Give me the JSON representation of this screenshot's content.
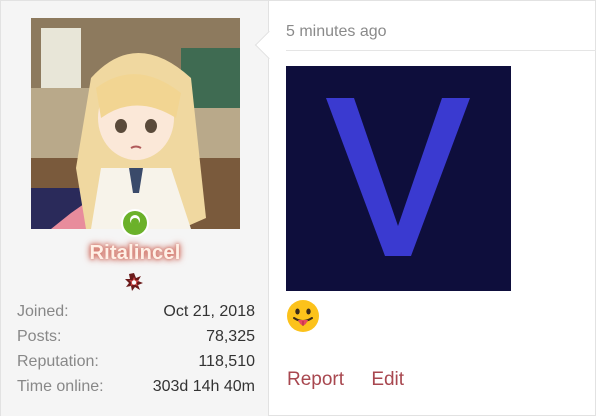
{
  "post": {
    "user": {
      "avatar": "avatar-image",
      "online_status": "online",
      "username": "Ritalincel",
      "username_glow_color": "#d4766a",
      "rank_icon": "rank-badge-icon",
      "stats": [
        {
          "label": "Joined:",
          "value": "Oct 21, 2018"
        },
        {
          "label": "Posts:",
          "value": "78,325"
        },
        {
          "label": "Reputation:",
          "value": "118,510"
        },
        {
          "label": "Time online:",
          "value": "303d 14h 40m"
        }
      ]
    },
    "timestamp": "5 minutes ago",
    "image": {
      "letter": "V",
      "background": "#0e0e3c",
      "letter_color": "#3a3ad0"
    },
    "emoji": "tongue-out-emoji",
    "actions": {
      "report": "Report",
      "edit": "Edit"
    },
    "link_color": "#a8474f"
  }
}
